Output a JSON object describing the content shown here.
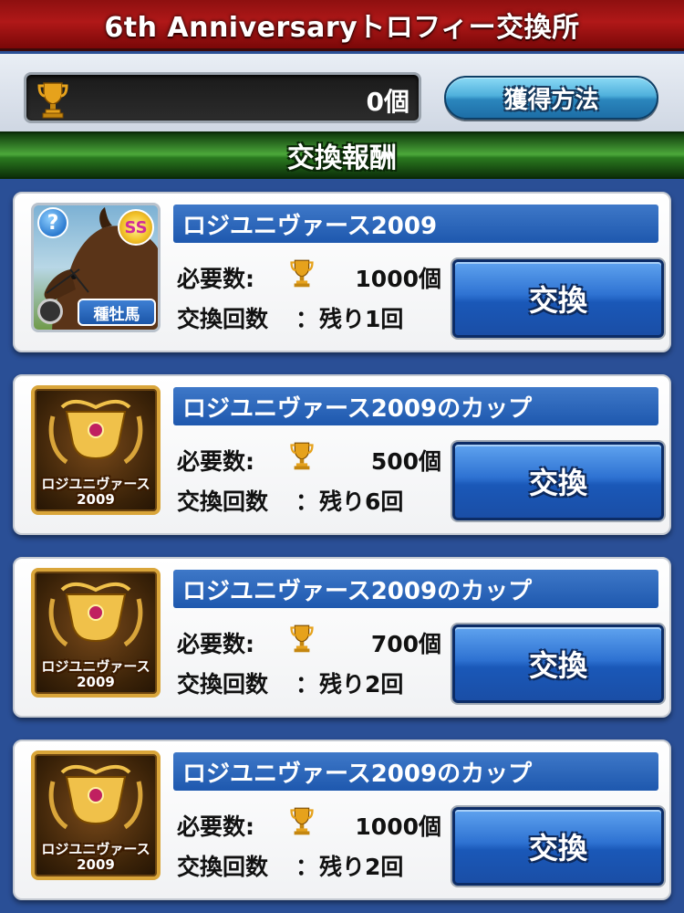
{
  "header": {
    "title": "6th Anniversaryトロフィー交換所"
  },
  "trophy_counter": {
    "count": "0個",
    "icon": "trophy-icon"
  },
  "howto_button": {
    "label": "獲得方法"
  },
  "section": {
    "title": "交換報酬"
  },
  "labels": {
    "required": "必要数:",
    "exchange_count": "交換回数",
    "colon": "："
  },
  "rewards": [
    {
      "name": "ロジユニヴァース2009",
      "required": "1000個",
      "remaining": "残り1回",
      "button": "交換",
      "thumb_type": "horse",
      "help": "?",
      "rank": "SS",
      "tag": "種牡馬"
    },
    {
      "name": "ロジユニヴァース2009のカップ",
      "required": "500個",
      "remaining": "残り6回",
      "button": "交換",
      "thumb_type": "cup",
      "cup_caption_1": "ロジユニヴァース",
      "cup_caption_2": "2009"
    },
    {
      "name": "ロジユニヴァース2009のカップ",
      "required": "700個",
      "remaining": "残り2回",
      "button": "交換",
      "thumb_type": "cup",
      "cup_caption_1": "ロジユニヴァース",
      "cup_caption_2": "2009"
    },
    {
      "name": "ロジユニヴァース2009のカップ",
      "required": "1000個",
      "remaining": "残り2回",
      "button": "交換",
      "thumb_type": "cup",
      "cup_caption_1": "ロジユニヴァース",
      "cup_caption_2": "2009"
    }
  ],
  "colors": {
    "title_bar": "#b01818",
    "background": "#2a4f96",
    "section_header": "#4ca83a",
    "name_bar": "#1e58ae",
    "exchange_button": "#2e72d2"
  }
}
